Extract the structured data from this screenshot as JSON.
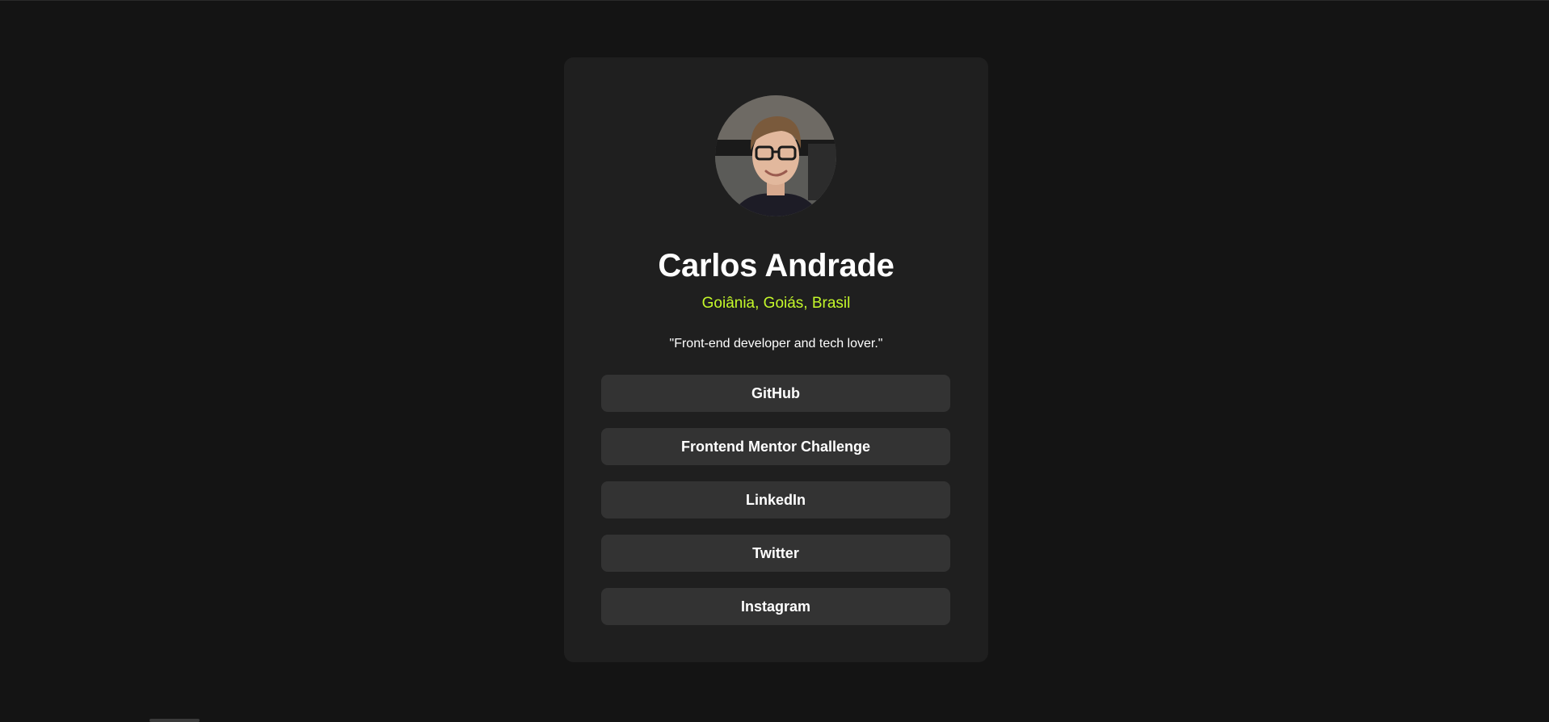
{
  "profile": {
    "name": "Carlos Andrade",
    "location": "Goiânia, Goiás, Brasil",
    "bio": "\"Front-end developer and tech lover.\""
  },
  "links": [
    {
      "label": "GitHub"
    },
    {
      "label": "Frontend Mentor Challenge"
    },
    {
      "label": "LinkedIn"
    },
    {
      "label": "Twitter"
    },
    {
      "label": "Instagram"
    }
  ],
  "colors": {
    "page_background": "#141414",
    "card_background": "#1f1f1f",
    "button_background": "#333333",
    "accent": "#c4f82a",
    "text": "#ffffff"
  },
  "icons": {
    "avatar": "profile-photo"
  }
}
